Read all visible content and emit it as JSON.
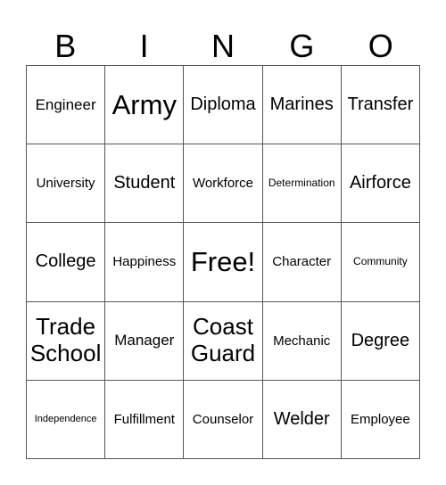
{
  "header": [
    "B",
    "I",
    "N",
    "G",
    "O"
  ],
  "cells": [
    [
      "Engineer",
      "Army",
      "Diploma",
      "Marines",
      "Transfer"
    ],
    [
      "University",
      "Student",
      "Workforce",
      "Determination",
      "Airforce"
    ],
    [
      "College",
      "Happiness",
      "Free!",
      "Character",
      "Community"
    ],
    [
      "Trade School",
      "Manager",
      "Coast Guard",
      "Mechanic",
      "Degree"
    ],
    [
      "Independence",
      "Fulfillment",
      "Counselor",
      "Welder",
      "Employee"
    ]
  ]
}
